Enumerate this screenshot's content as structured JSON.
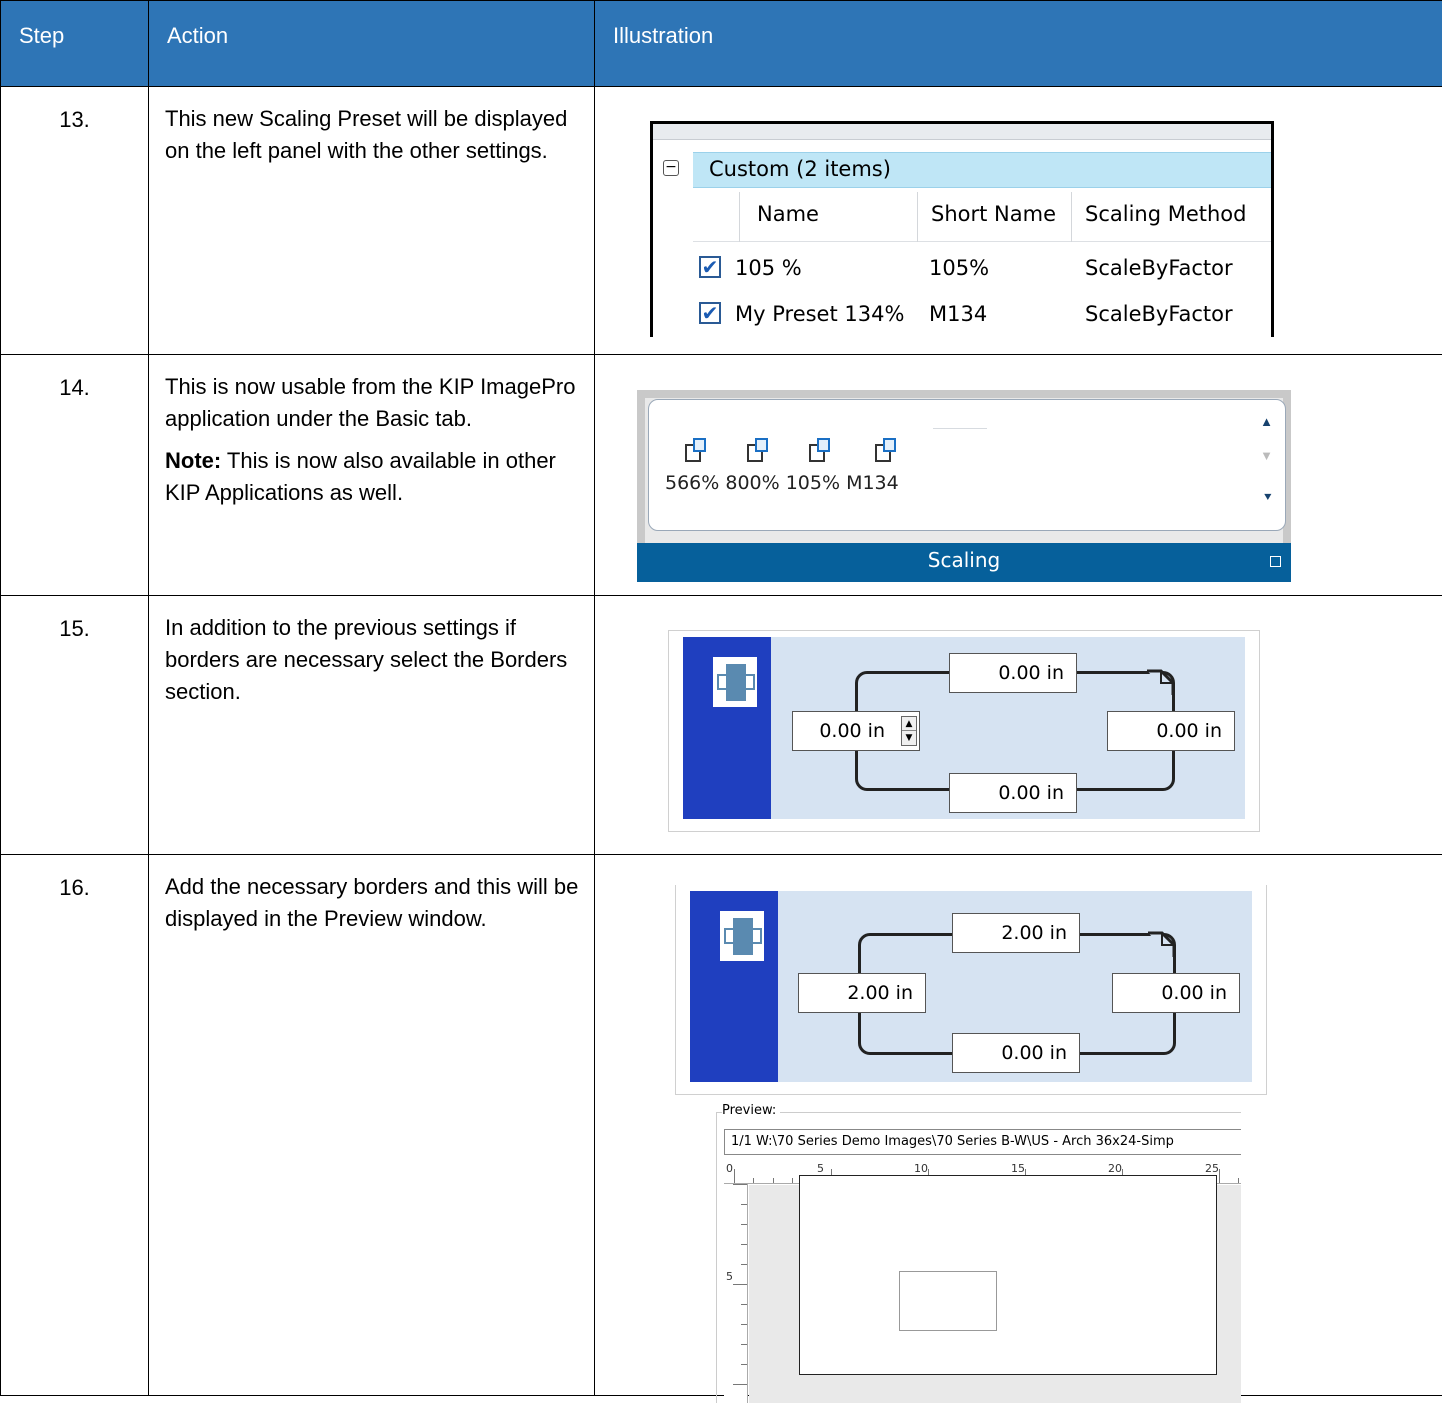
{
  "header": {
    "step": "Step",
    "action": "Action",
    "illustration": "Illustration"
  },
  "rows": [
    {
      "step": "13.",
      "action": [
        "This new Scaling Preset will be displayed on the left panel with the other settings."
      ],
      "grid": {
        "collapse_symbol": "−",
        "group_label": "Custom (2 items)",
        "columns": [
          "Name",
          "Short Name",
          "Scaling Method"
        ],
        "items": [
          {
            "checked": true,
            "check_glyph": "✔",
            "name": "105 %",
            "short": "105%",
            "method": "ScaleByFactor"
          },
          {
            "checked": true,
            "check_glyph": "✔",
            "name": "My Preset 134%",
            "short": "M134",
            "method": "ScaleByFactor"
          }
        ]
      }
    },
    {
      "step": "14.",
      "action": [
        "This is now usable from the KIP ImagePro application under the Basic tab."
      ],
      "note_label": "Note:",
      "note_text": " This is now also available in other KIP Applications as well.",
      "ribbon": {
        "labels": "566% 800% 105% M134",
        "group_title": "Scaling",
        "scroll_up": "▲",
        "scroll_down": "▼",
        "scroll_more": "⯆"
      }
    },
    {
      "step": "15.",
      "action": [
        "In addition to the previous settings if borders are necessary select the Borders section."
      ],
      "borders": {
        "top": "0.00 in",
        "left": "0.00 in",
        "right": "0.00 in",
        "bottom": "0.00 in",
        "spin_up": "▲",
        "spin_down": "▼"
      }
    },
    {
      "step": "16.",
      "action": [
        "Add the necessary borders and this will be displayed in the Preview window."
      ],
      "borders": {
        "top": "2.00 in",
        "left": "2.00 in",
        "right": "0.00 in",
        "bottom": "0.00 in"
      },
      "preview": {
        "legend": "Preview:",
        "path": "1/1   W:\\70 Series Demo Images\\70 Series B-W\\US - Arch 36x24-Simp",
        "ruler_h": [
          "0",
          "5",
          "10",
          "15",
          "20",
          "25"
        ],
        "ruler_v": [
          "0",
          "5"
        ]
      }
    }
  ],
  "colors": {
    "header_bg": "#2e75b6",
    "ribbon_footer": "#06609b",
    "borders_blue": "#1f3fbf",
    "borders_bg": "#d6e3f2",
    "group_highlight": "#bfe6f6"
  }
}
